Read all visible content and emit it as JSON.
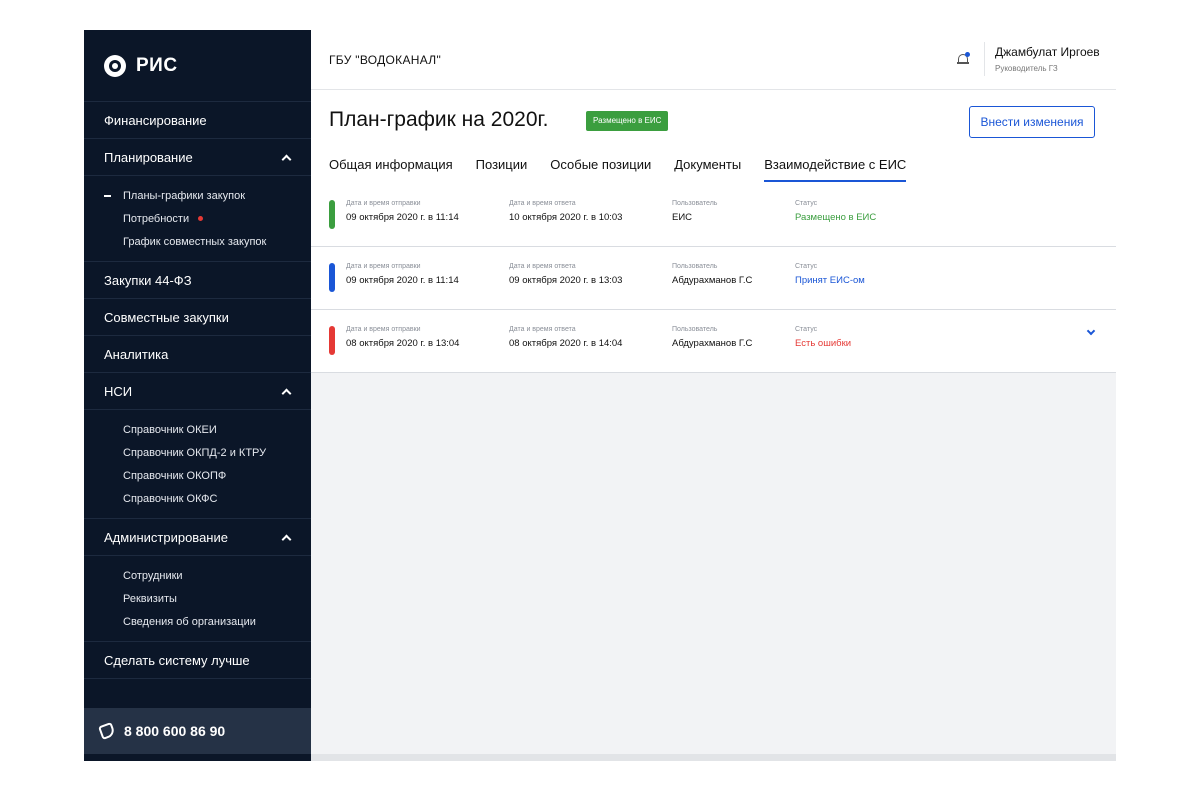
{
  "app": {
    "name": "РИС"
  },
  "header": {
    "org_name": "ГБУ \"ВОДОКАНАЛ\"",
    "user_name": "Джамбулат Иргоев",
    "user_role": "Руководитель ГЗ"
  },
  "sidebar": {
    "nav": [
      {
        "label": "Финансирование"
      },
      {
        "label": "Планирование",
        "expanded": true
      },
      {
        "label": "Закупки 44-ФЗ"
      },
      {
        "label": "Совместные закупки"
      },
      {
        "label": "Аналитика"
      },
      {
        "label": "НСИ",
        "expanded": true
      },
      {
        "label": "Администрирование",
        "expanded": true
      },
      {
        "label": "Сделать систему лучше"
      }
    ],
    "planning_sub": [
      {
        "label": "Планы-графики закупок",
        "active": true
      },
      {
        "label": "Потребности",
        "has_notification": true
      },
      {
        "label": "График совместных закупок"
      }
    ],
    "nsi_sub": [
      {
        "label": "Справочник ОКЕИ"
      },
      {
        "label": "Справочник ОКПД-2 и КТРУ"
      },
      {
        "label": "Справочник ОКОПФ"
      },
      {
        "label": "Справочник ОКФС"
      }
    ],
    "admin_sub": [
      {
        "label": "Сотрудники"
      },
      {
        "label": "Реквизиты"
      },
      {
        "label": "Сведения об организации"
      }
    ],
    "phone": "8 800 600 86 90"
  },
  "page": {
    "title": "План-график на 2020г.",
    "status_badge": "Размещено в ЕИС",
    "edit_button": "Внести изменения",
    "tabs": [
      {
        "label": "Общая информация"
      },
      {
        "label": "Позиции"
      },
      {
        "label": "Особые позиции"
      },
      {
        "label": "Документы"
      },
      {
        "label": "Взаимодействие с ЕИС",
        "active": true
      }
    ]
  },
  "records": {
    "labels": {
      "sent": "Дата и время отправки",
      "answered": "Дата и время ответа",
      "user": "Пользователь",
      "status": "Статус"
    },
    "items": [
      {
        "sent": "09 октября 2020 г. в 11:14",
        "answered": "10 октября 2020 г. в 10:03",
        "user": "ЕИС",
        "status": "Размещено в ЕИС",
        "color": "#3b9e3f"
      },
      {
        "sent": "09 октября 2020 г. в 11:14",
        "answered": "09 октября 2020 г. в 13:03",
        "user": "Абдурахманов Г.С",
        "status": "Принят ЕИС-ом",
        "color": "#1a56d6"
      },
      {
        "sent": "08 октября 2020 г. в 13:04",
        "answered": "08 октября 2020 г. в 14:04",
        "user": "Абдурахманов Г.С",
        "status": "Есть ошибки",
        "color": "#e53935"
      }
    ]
  },
  "icons": {
    "logo": "emblem-icon",
    "bell": "bell-icon",
    "phone": "phone-icon",
    "expand": "chevron-down-icon",
    "collapse": "chevron-up-icon"
  }
}
